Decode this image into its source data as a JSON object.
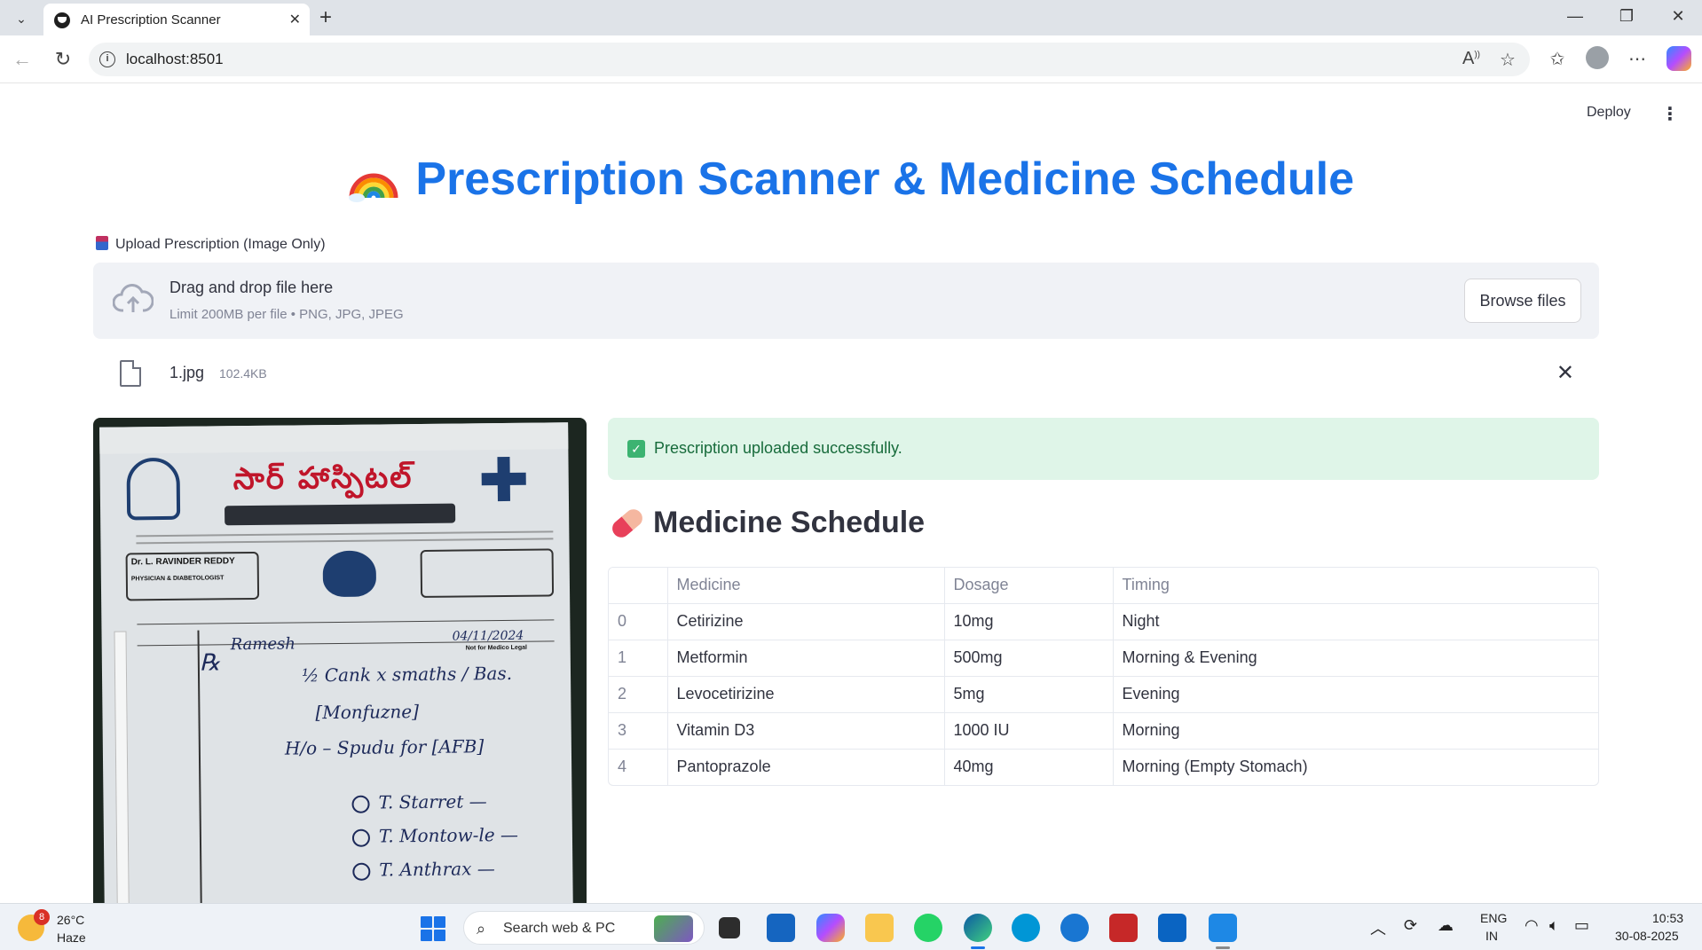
{
  "browser": {
    "tab_title": "AI Prescription Scanner",
    "url": "localhost:8501"
  },
  "app": {
    "deploy_label": "Deploy",
    "title": "Prescription Scanner & Medicine Schedule",
    "title_icon": "rainbow-icon",
    "uploader": {
      "label": "Upload Prescription (Image Only)",
      "drop_title": "Drag and drop file here",
      "drop_subtitle": "Limit 200MB per file • PNG, JPG, JPEG",
      "browse_label": "Browse files"
    },
    "uploaded_file": {
      "name": "1.jpg",
      "size": "102.4KB"
    },
    "success_message": "Prescription uploaded successfully.",
    "schedule_title": "Medicine Schedule",
    "schedule_icon": "pill-icon",
    "table": {
      "headers": [
        "",
        "Medicine",
        "Dosage",
        "Timing"
      ],
      "rows": [
        {
          "index": "0",
          "medicine": "Cetirizine",
          "dosage": "10mg",
          "timing": "Night"
        },
        {
          "index": "1",
          "medicine": "Metformin",
          "dosage": "500mg",
          "timing": "Morning & Evening"
        },
        {
          "index": "2",
          "medicine": "Levocetirizine",
          "dosage": "5mg",
          "timing": "Evening"
        },
        {
          "index": "3",
          "medicine": "Vitamin D3",
          "dosage": "1000 IU",
          "timing": "Morning"
        },
        {
          "index": "4",
          "medicine": "Pantoprazole",
          "dosage": "40mg",
          "timing": "Morning (Empty Stomach)"
        }
      ]
    },
    "prescription_image": {
      "doctor_name": "Dr. L. RAVINDER REDDY",
      "doctor_title": "PHYSICIAN & DIABETOLOGIST",
      "stamp_text": "Not for Medico Legal"
    }
  },
  "taskbar": {
    "weather_temp": "26°C",
    "weather_desc": "Haze",
    "weather_badge": "8",
    "search_placeholder": "Search web & PC",
    "lang_line1": "ENG",
    "lang_line2": "IN",
    "time": "10:53",
    "date": "30-08-2025"
  },
  "colors": {
    "title_blue": "#1a73e8",
    "success_bg": "#dff5e8",
    "success_text": "#176b3b",
    "dropzone_bg": "#f0f2f6"
  }
}
